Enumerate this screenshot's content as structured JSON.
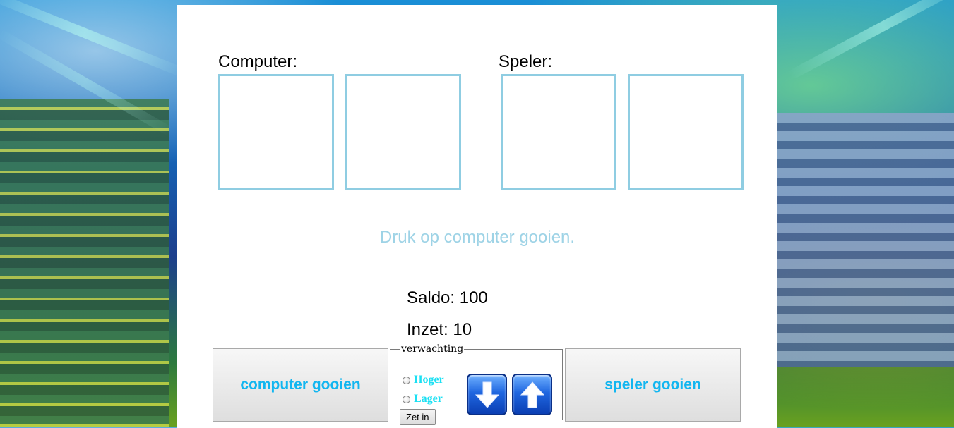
{
  "computer": {
    "label": "Computer:"
  },
  "player": {
    "label": "Speler:"
  },
  "message": "Druk op computer gooien.",
  "stats": {
    "saldo_label": "Saldo: 100",
    "inzet_label": "Inzet: 10"
  },
  "buttons": {
    "computer_roll": "computer gooien",
    "player_roll": "speler gooien",
    "place_bet": "Zet in"
  },
  "expectation": {
    "legend": "verwachting",
    "options": [
      "Hoger",
      "Lager"
    ],
    "selected": null
  },
  "icons": {
    "down": "arrow-down-icon",
    "up": "arrow-up-icon"
  },
  "colors": {
    "dice_border": "#8fcde2",
    "message": "#9ed3e6",
    "button_text": "#12b6f0",
    "radio_text": "#1be0f3"
  }
}
